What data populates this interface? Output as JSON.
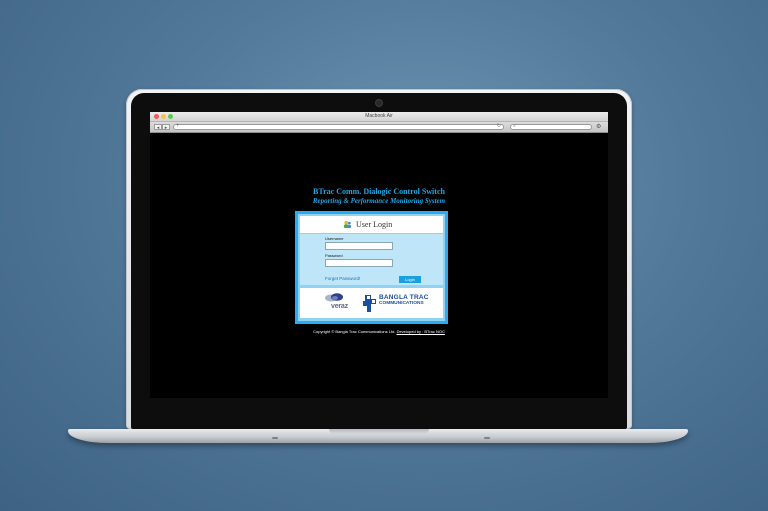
{
  "browser": {
    "window_title": "Macbook Air",
    "url_value": "",
    "search_value": ""
  },
  "page": {
    "heading_main": "BTrac Comm. Dialogic Control Switch",
    "heading_sub": "Reporting & Performance Monitoring System",
    "login": {
      "title": "User Login",
      "username_label": "Username",
      "username_value": "",
      "password_label": "Password",
      "password_value": "",
      "forget_link": "Forget Password!",
      "login_button": "Login"
    },
    "logos": {
      "veraz": "veraz",
      "btrac_line1": "BANGLA TRAC",
      "btrac_line2": "COMMUNICATIONS"
    },
    "footer": {
      "copyright": "Copyright © Bangla Trac Communications Ltd.",
      "developed_by": "Developed by : BTrac NOC"
    }
  },
  "colors": {
    "background": "#52789a",
    "accent_blue": "#1fa3e6",
    "login_border": "#2eaaf0",
    "screen": "#000000"
  }
}
